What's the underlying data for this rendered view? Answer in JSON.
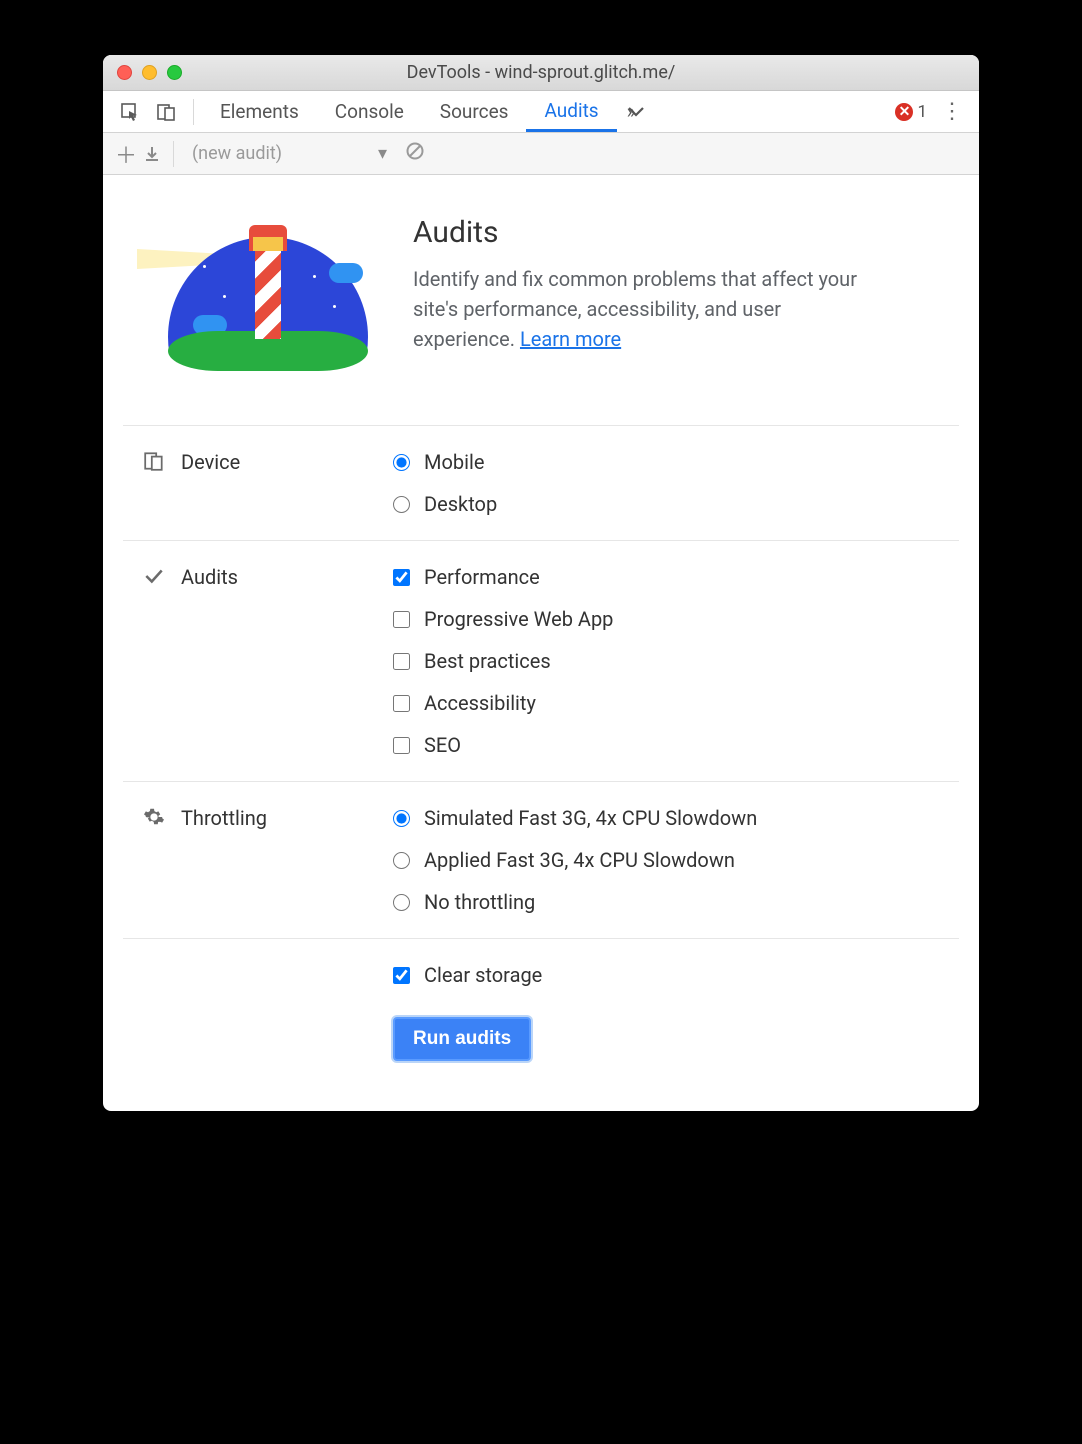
{
  "window": {
    "title": "DevTools - wind-sprout.glitch.me/"
  },
  "tabs": {
    "items": [
      "Elements",
      "Console",
      "Sources",
      "Audits"
    ],
    "active": "Audits",
    "error_count": "1"
  },
  "subtoolbar": {
    "dropdown": "(new audit)"
  },
  "intro": {
    "heading": "Audits",
    "body": "Identify and fix common problems that affect your site's performance, accessibility, and user experience. ",
    "link": "Learn more"
  },
  "device": {
    "label": "Device",
    "options": [
      {
        "label": "Mobile",
        "checked": true
      },
      {
        "label": "Desktop",
        "checked": false
      }
    ]
  },
  "audits": {
    "label": "Audits",
    "options": [
      {
        "label": "Performance",
        "checked": true
      },
      {
        "label": "Progressive Web App",
        "checked": false
      },
      {
        "label": "Best practices",
        "checked": false
      },
      {
        "label": "Accessibility",
        "checked": false
      },
      {
        "label": "SEO",
        "checked": false
      }
    ]
  },
  "throttling": {
    "label": "Throttling",
    "options": [
      {
        "label": "Simulated Fast 3G, 4x CPU Slowdown",
        "checked": true
      },
      {
        "label": "Applied Fast 3G, 4x CPU Slowdown",
        "checked": false
      },
      {
        "label": "No throttling",
        "checked": false
      }
    ]
  },
  "storage": {
    "label": "Clear storage",
    "checked": true
  },
  "run_button": "Run audits"
}
